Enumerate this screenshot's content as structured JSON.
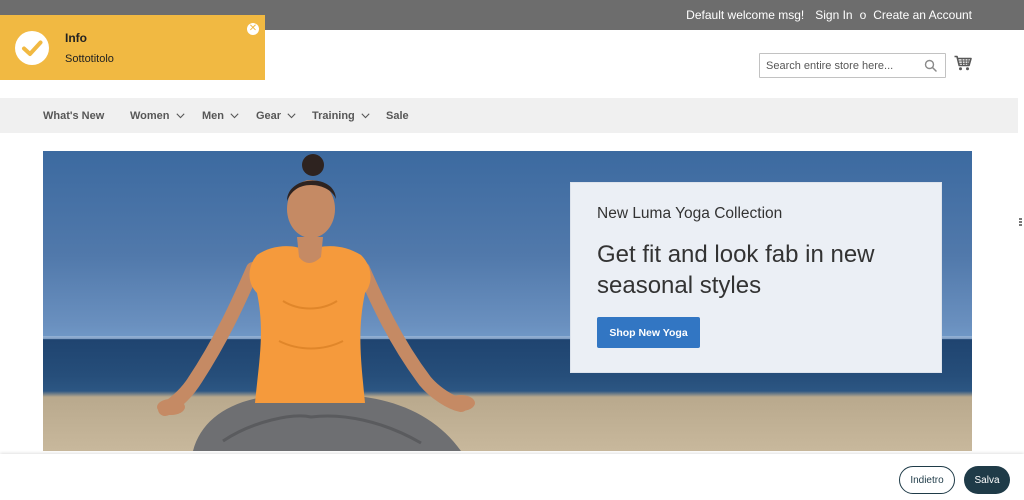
{
  "header": {
    "welcome": "Default welcome msg!",
    "sign_in": "Sign In",
    "separator": "o",
    "create_account": "Create an Account"
  },
  "toast": {
    "title": "Info",
    "subtitle": "Sottotitolo",
    "close_glyph": "✕",
    "icon": "check-icon",
    "color": "#f1b942"
  },
  "search": {
    "placeholder": "Search entire store here..."
  },
  "nav": {
    "items": [
      {
        "label": "What's New",
        "has_dropdown": false
      },
      {
        "label": "Women",
        "has_dropdown": true
      },
      {
        "label": "Men",
        "has_dropdown": true
      },
      {
        "label": "Gear",
        "has_dropdown": true
      },
      {
        "label": "Training",
        "has_dropdown": true
      },
      {
        "label": "Sale",
        "has_dropdown": false
      }
    ]
  },
  "hero": {
    "subtitle": "New Luma Yoga Collection",
    "title": "Get fit and look fab in new seasonal styles",
    "cta": "Shop New Yoga",
    "cta_color": "#3276c3"
  },
  "footer": {
    "back_label": "Indietro",
    "save_label": "Salva",
    "accent": "#1f3b48"
  }
}
